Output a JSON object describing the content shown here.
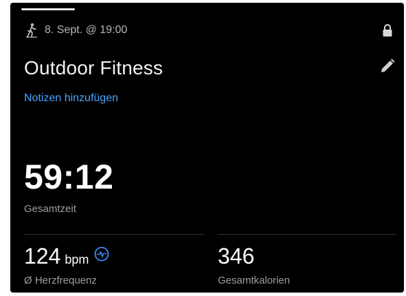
{
  "header": {
    "date_text": "8. Sept. @ 19:00",
    "activity_icon": "hiking-person-icon",
    "lock_icon": "lock-icon"
  },
  "activity": {
    "title": "Outdoor Fitness",
    "edit_icon": "pencil-icon",
    "notes_link": "Notizen hinzufügen"
  },
  "stats": {
    "total_time": {
      "value": "59:12",
      "label": "Gesamtzeit"
    },
    "heart_rate": {
      "value": "124",
      "unit": "bpm",
      "label": "Ø Herzfrequenz",
      "icon": "heart-rate-icon"
    },
    "calories": {
      "value": "346",
      "label": "Gesamtkalorien"
    }
  },
  "colors": {
    "background": "#000000",
    "accent": "#4aa3ff",
    "text_primary": "#ffffff",
    "text_secondary": "#9e9e9e"
  }
}
